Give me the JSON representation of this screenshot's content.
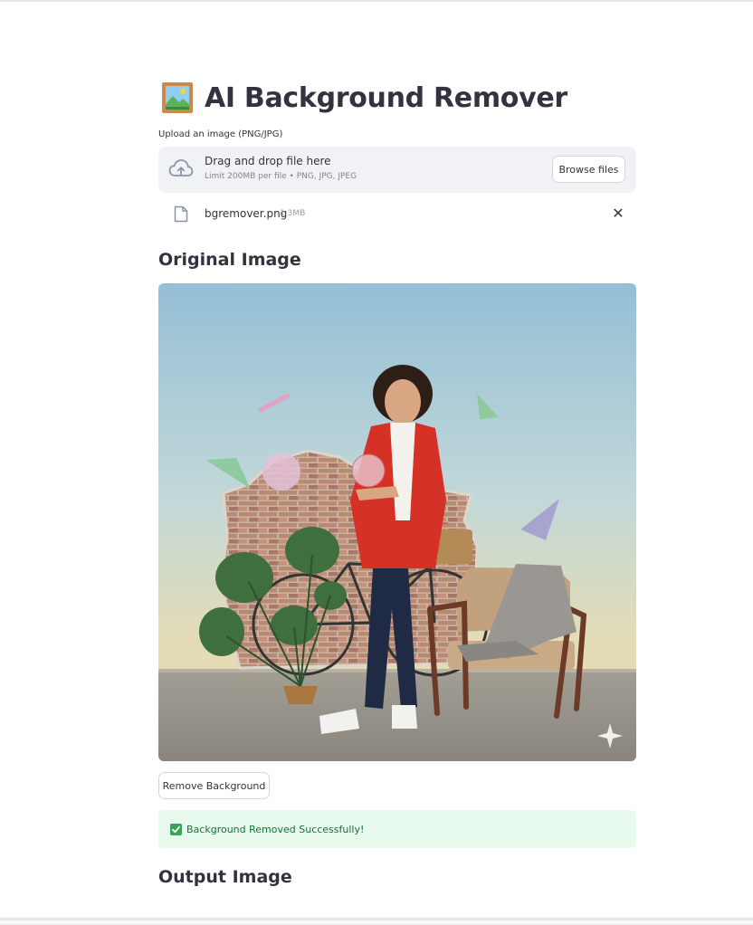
{
  "app": {
    "title": "AI Background Remover",
    "title_icon": "framed-picture-icon"
  },
  "uploader": {
    "label": "Upload an image (PNG/JPG)",
    "drop_text": "Drag and drop file here",
    "limit_text": "Limit 200MB per file • PNG, JPG, JPEG",
    "browse_label": "Browse files",
    "icons": {
      "upload": "cloud-upload-icon",
      "file": "file-icon",
      "remove": "close-icon"
    }
  },
  "uploaded_file": {
    "name": "bgremover.png",
    "size": "1.3MB"
  },
  "sections": {
    "original_title": "Original Image",
    "output_title": "Output Image"
  },
  "actions": {
    "remove_background_label": "Remove Background"
  },
  "status": {
    "message": "Background Removed Successfully!",
    "icon": "check-mark-icon"
  },
  "colors": {
    "text": "#31333f",
    "dropzone_bg": "#f0f2f6",
    "success_bg": "#e8f9ee",
    "success_text": "#177233",
    "check_green": "#3aa55a"
  }
}
